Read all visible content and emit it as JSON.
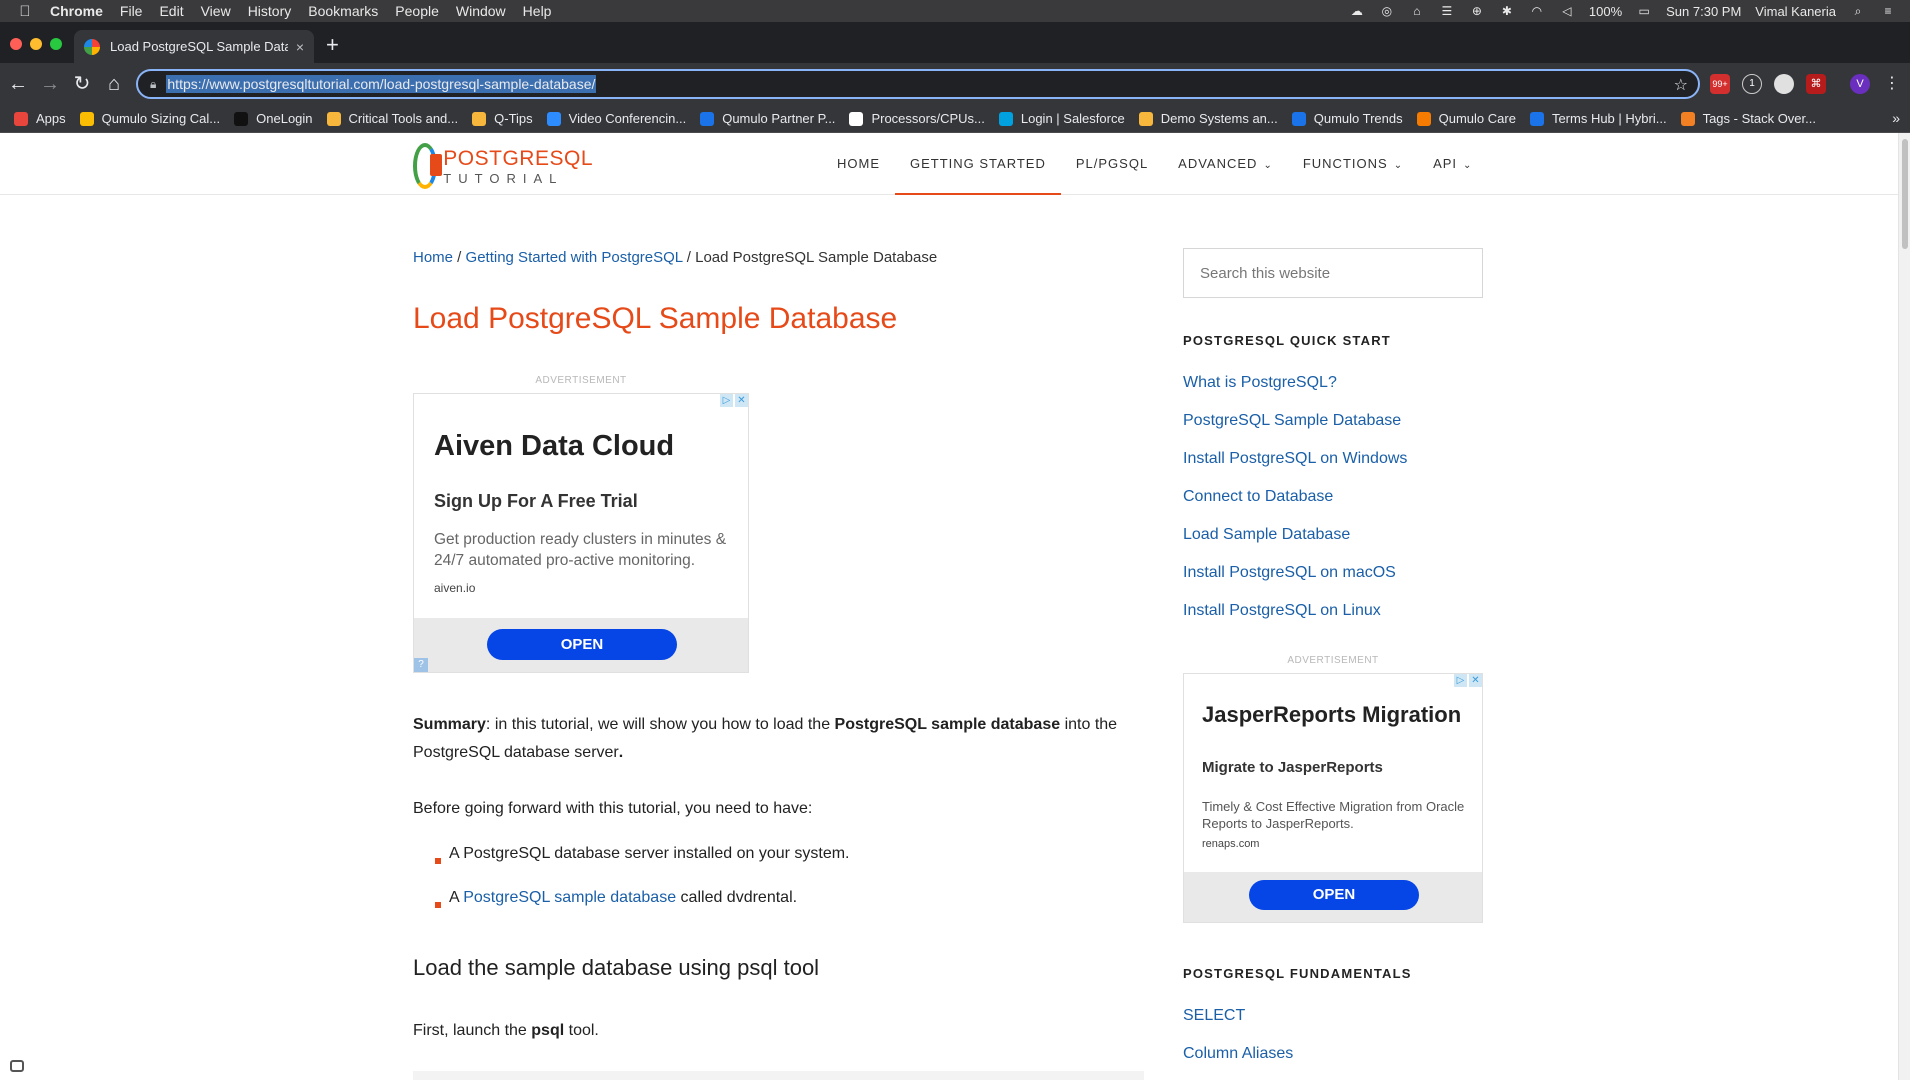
{
  "menubar": {
    "app": "Chrome",
    "items": [
      "File",
      "Edit",
      "View",
      "History",
      "Bookmarks",
      "People",
      "Window",
      "Help"
    ],
    "battery": "100%",
    "clock": "Sun 7:30 PM",
    "user": "Vimal Kaneria"
  },
  "tab": {
    "title": "Load PostgreSQL Sample Data",
    "close": "×"
  },
  "newtab": "+",
  "omnibox": {
    "url": "https://www.postgresqltutorial.com/load-postgresql-sample-database/"
  },
  "extensions": {
    "badge": "99+",
    "profile": "V"
  },
  "bookmarks": [
    {
      "label": "Apps",
      "color": "#e8453c"
    },
    {
      "label": "Qumulo Sizing Cal...",
      "color": "#fbbc04"
    },
    {
      "label": "OneLogin",
      "color": "#111111"
    },
    {
      "label": "Critical Tools and...",
      "color": "#f6b73c"
    },
    {
      "label": "Q-Tips",
      "color": "#f6b73c"
    },
    {
      "label": "Video Conferencin...",
      "color": "#2d8cff"
    },
    {
      "label": "Qumulo Partner P...",
      "color": "#1a73e8"
    },
    {
      "label": "Processors/CPUs...",
      "color": "#ffffff"
    },
    {
      "label": "Login | Salesforce",
      "color": "#00a1e0"
    },
    {
      "label": "Demo Systems an...",
      "color": "#f6b73c"
    },
    {
      "label": "Qumulo Trends",
      "color": "#1a73e8"
    },
    {
      "label": "Qumulo Care",
      "color": "#f57c00"
    },
    {
      "label": "Terms Hub | Hybri...",
      "color": "#1a73e8"
    },
    {
      "label": "Tags - Stack Over...",
      "color": "#f48024"
    }
  ],
  "site": {
    "logo_line1": "POSTGRESQL",
    "logo_line2": "TUTORIAL",
    "nav": [
      {
        "label": "HOME",
        "dropdown": false
      },
      {
        "label": "GETTING STARTED",
        "dropdown": false
      },
      {
        "label": "PL/PGSQL",
        "dropdown": false
      },
      {
        "label": "ADVANCED",
        "dropdown": true
      },
      {
        "label": "FUNCTIONS",
        "dropdown": true
      },
      {
        "label": "API",
        "dropdown": true
      }
    ]
  },
  "breadcrumb": {
    "home": "Home",
    "sep": " / ",
    "section": "Getting Started with PostgreSQL",
    "current": "Load PostgreSQL Sample Database"
  },
  "article": {
    "title": "Load PostgreSQL Sample Database",
    "summary_label": "Summary",
    "summary_part1": ": in this tutorial, we will show you how to load the ",
    "summary_bold": "PostgreSQL sample database",
    "summary_part2": " into the",
    "summary_line2": "PostgreSQL database server",
    "summary_end": ".",
    "before": "Before going forward with this tutorial, you need to have:",
    "bullet1": "A PostgreSQL database server installed on your system.",
    "bullet2_prefix": "A ",
    "bullet2_link": "PostgreSQL sample database",
    "bullet2_suffix": " called dvdrental.",
    "h2": "Load the sample database using psql tool",
    "first_prefix": "First, launch the ",
    "first_bold": "psql",
    "first_suffix": " tool."
  },
  "ad1": {
    "label": "ADVERTISEMENT",
    "title": "Aiven Data Cloud",
    "subtitle": "Sign Up For A Free Trial",
    "body": "Get production ready clusters in minutes & 24/7 automated pro-active monitoring.",
    "domain": "aiven.io",
    "cta": "OPEN"
  },
  "sidebar": {
    "search_placeholder": "Search this website",
    "quickstart_title": "POSTGRESQL QUICK START",
    "quickstart": [
      "What is PostgreSQL?",
      "PostgreSQL Sample Database",
      "Install PostgreSQL on Windows",
      "Connect to Database",
      "Load Sample Database",
      "Install PostgreSQL on macOS",
      "Install PostgreSQL on Linux"
    ],
    "fundamentals_title": "POSTGRESQL FUNDAMENTALS",
    "fundamentals": [
      "SELECT",
      "Column Aliases"
    ]
  },
  "ad2": {
    "label": "ADVERTISEMENT",
    "title": "JasperReports Migration",
    "subtitle": "Migrate to JasperReports",
    "body": "Timely & Cost Effective Migration from Oracle Reports to JasperReports.",
    "domain": "renaps.com",
    "cta": "OPEN"
  }
}
